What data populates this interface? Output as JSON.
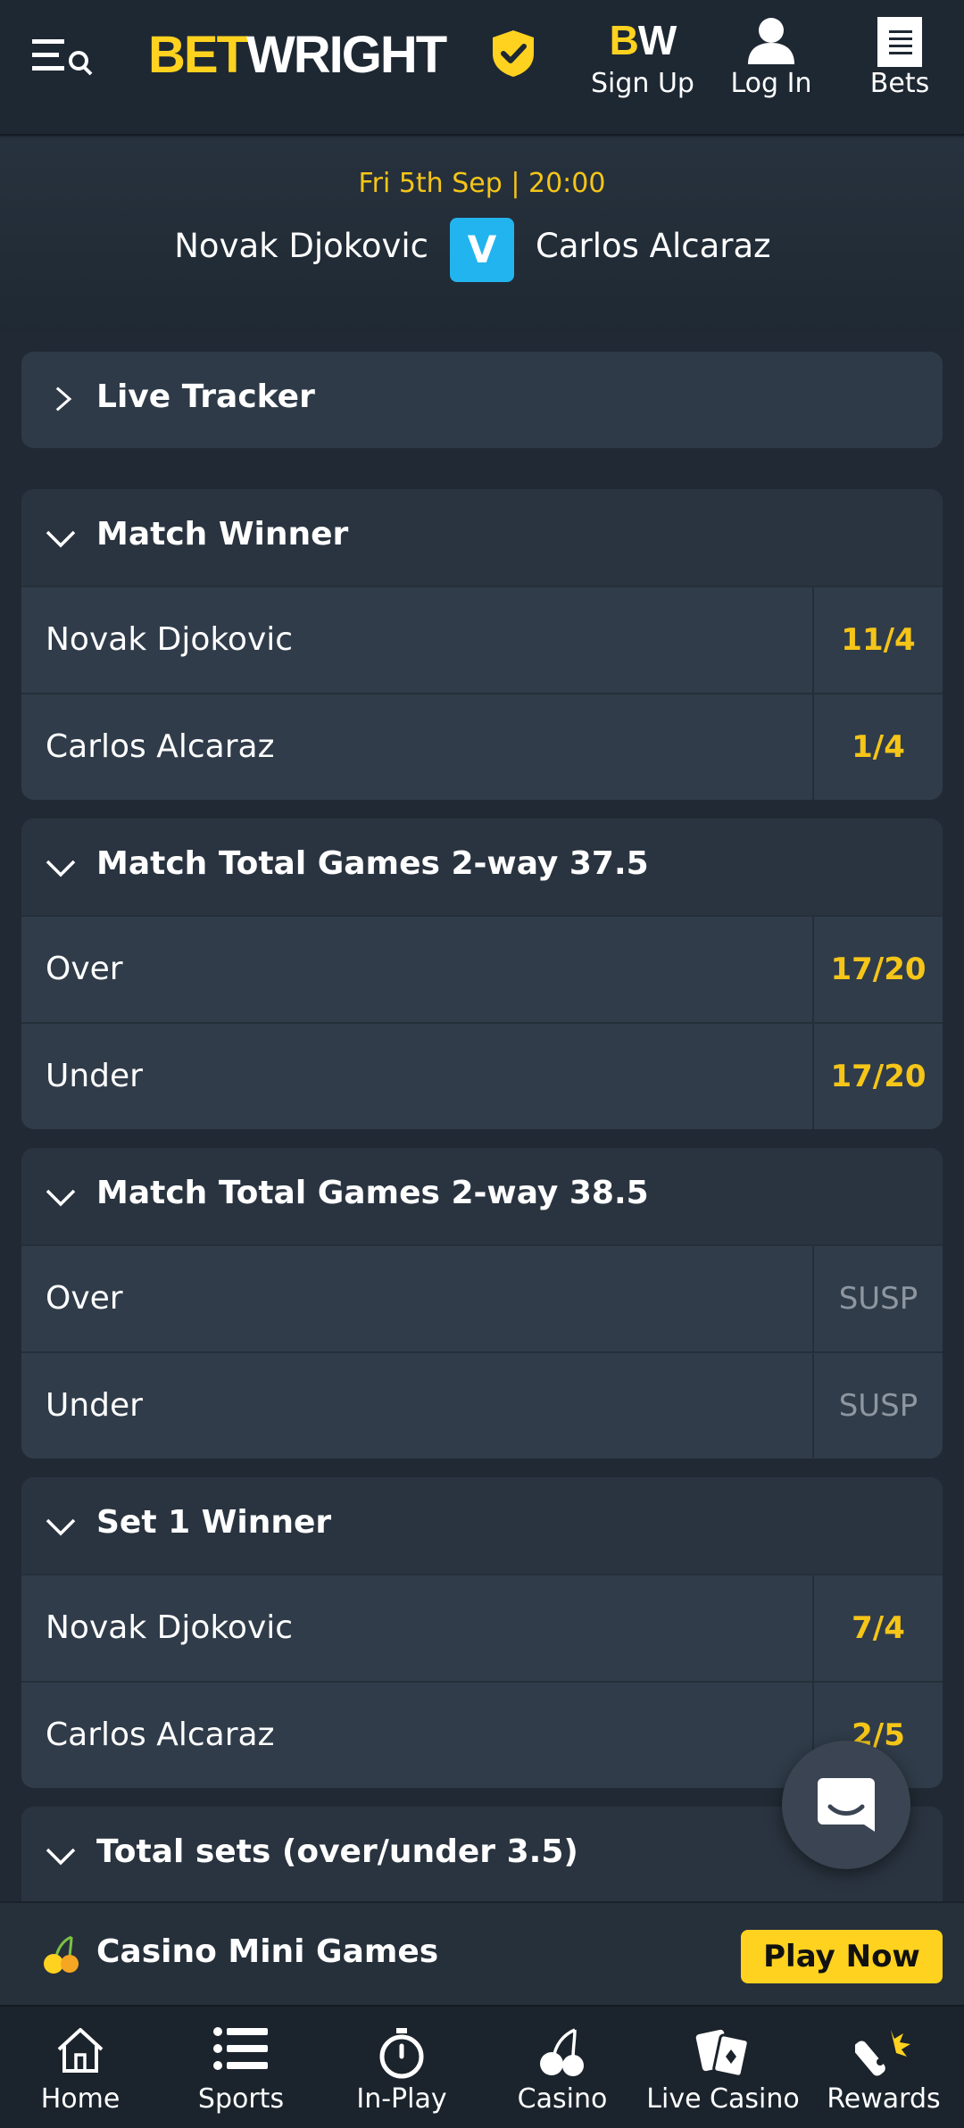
{
  "header": {
    "logo_part1": "BET",
    "logo_part2": "WRIGHT",
    "signup_mark_b": "B",
    "signup_mark_w": "W",
    "signup_label": "Sign Up",
    "login_label": "Log In",
    "bets_label": "Bets"
  },
  "event": {
    "date": "Fri 5th Sep",
    "separator": "|",
    "time": "20:00",
    "home": "Novak Djokovic",
    "vs": "V",
    "away": "Carlos Alcaraz"
  },
  "live_tracker": {
    "title": "Live Tracker"
  },
  "markets": [
    {
      "title": "Match Winner",
      "rows": [
        {
          "selection": "Novak Djokovic",
          "odds": "11/4"
        },
        {
          "selection": "Carlos Alcaraz",
          "odds": "1/4"
        }
      ]
    },
    {
      "title": "Match Total Games 2-way 37.5",
      "rows": [
        {
          "selection": "Over",
          "odds": "17/20"
        },
        {
          "selection": "Under",
          "odds": "17/20"
        }
      ]
    },
    {
      "title": "Match Total Games 2-way 38.5",
      "rows": [
        {
          "selection": "Over",
          "odds": "SUSP"
        },
        {
          "selection": "Under",
          "odds": "SUSP"
        }
      ]
    },
    {
      "title": "Set 1 Winner",
      "rows": [
        {
          "selection": "Novak Djokovic",
          "odds": "7/4"
        },
        {
          "selection": "Carlos Alcaraz",
          "odds": "2/5"
        }
      ]
    },
    {
      "title": "Total sets (over/under 3.5)",
      "rows": []
    }
  ],
  "promo": {
    "title": "Casino Mini Games",
    "button": "Play Now"
  },
  "bottom_nav": [
    {
      "label": "Home",
      "icon": "home-icon"
    },
    {
      "label": "Sports",
      "icon": "list-icon"
    },
    {
      "label": "In-Play",
      "icon": "stopwatch-icon"
    },
    {
      "label": "Casino",
      "icon": "cherry-icon"
    },
    {
      "label": "Live Casino",
      "icon": "cards-icon"
    },
    {
      "label": "Rewards",
      "icon": "rewards-icon"
    }
  ],
  "colors": {
    "accent_yellow": "#ffd21f",
    "odds_yellow": "#f5c518",
    "vs_blue": "#22b4ee",
    "background": "#212a34",
    "card": "#2f3a48",
    "suspended_grey": "#8e96a1"
  }
}
